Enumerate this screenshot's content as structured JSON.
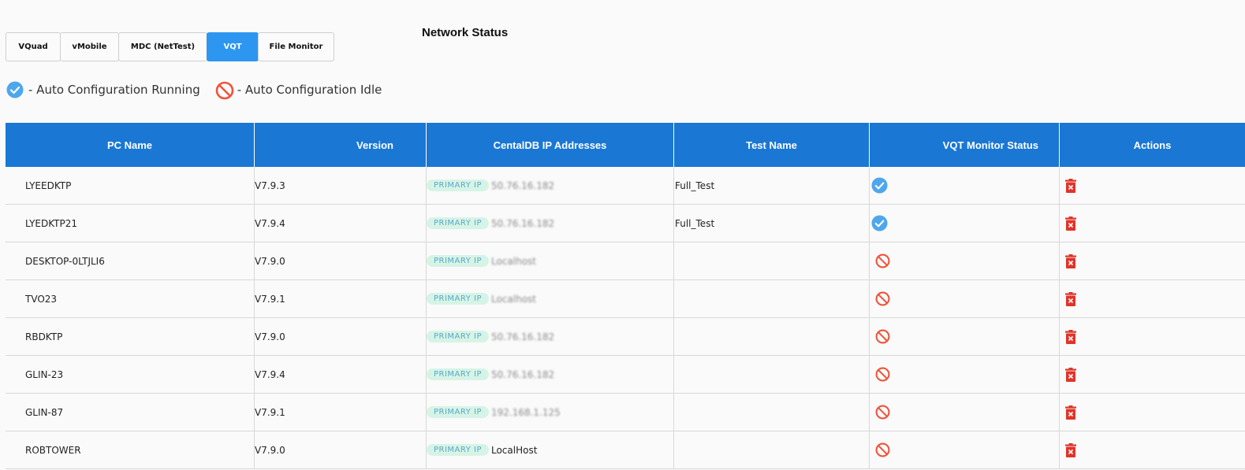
{
  "tabs": [
    {
      "label": "VQuad",
      "active": false
    },
    {
      "label": "vMobile",
      "active": false
    },
    {
      "label": "MDC (NetTest)",
      "active": false
    },
    {
      "label": "VQT",
      "active": true
    },
    {
      "label": "File Monitor",
      "active": false
    }
  ],
  "page": {
    "title": "Network Status"
  },
  "legend": {
    "running_label": "- Auto Configuration Running",
    "idle_label": "- Auto Configuration Idle",
    "running_icon": "check-circle-icon",
    "idle_icon": "ban-icon"
  },
  "table": {
    "headers": [
      "PC Name",
      "Version",
      "CentalDB IP Addresses",
      "Test Name",
      "VQT Monitor Status",
      "Actions"
    ],
    "badge_label": "PRIMARY IP",
    "rows": [
      {
        "pc": "LYEEDKTP",
        "version": "V7.9.3",
        "ip": "50.76.16.182",
        "test": "Full_Test",
        "status": "running"
      },
      {
        "pc": "LYEDKTP21",
        "version": "V7.9.4",
        "ip": "50.76.16.182",
        "test": "Full_Test",
        "status": "running"
      },
      {
        "pc": "DESKTOP-0LTJLI6",
        "version": "V7.9.0",
        "ip": "Localhost",
        "test": "",
        "status": "idle"
      },
      {
        "pc": "TVO23",
        "version": "V7.9.1",
        "ip": "Localhost",
        "test": "",
        "status": "idle"
      },
      {
        "pc": "RBDKTP",
        "version": "V7.9.0",
        "ip": "50.76.16.182",
        "test": "",
        "status": "idle"
      },
      {
        "pc": "GLIN-23",
        "version": "V7.9.4",
        "ip": "50.76.16.182",
        "test": "",
        "status": "idle"
      },
      {
        "pc": "GLIN-87",
        "version": "V7.9.1",
        "ip": "192.168.1.125",
        "test": "",
        "status": "idle"
      },
      {
        "pc": "ROBTOWER",
        "version": "V7.9.0",
        "ip": "LocalHost",
        "test": "",
        "status": "idle"
      }
    ]
  },
  "colors": {
    "header_bg": "#1a77d4",
    "active_tab": "#2d96f1",
    "running": "#4ea7ec",
    "idle": "#f0533b",
    "delete": "#e0342a",
    "badge_bg": "#d6f4e6"
  }
}
